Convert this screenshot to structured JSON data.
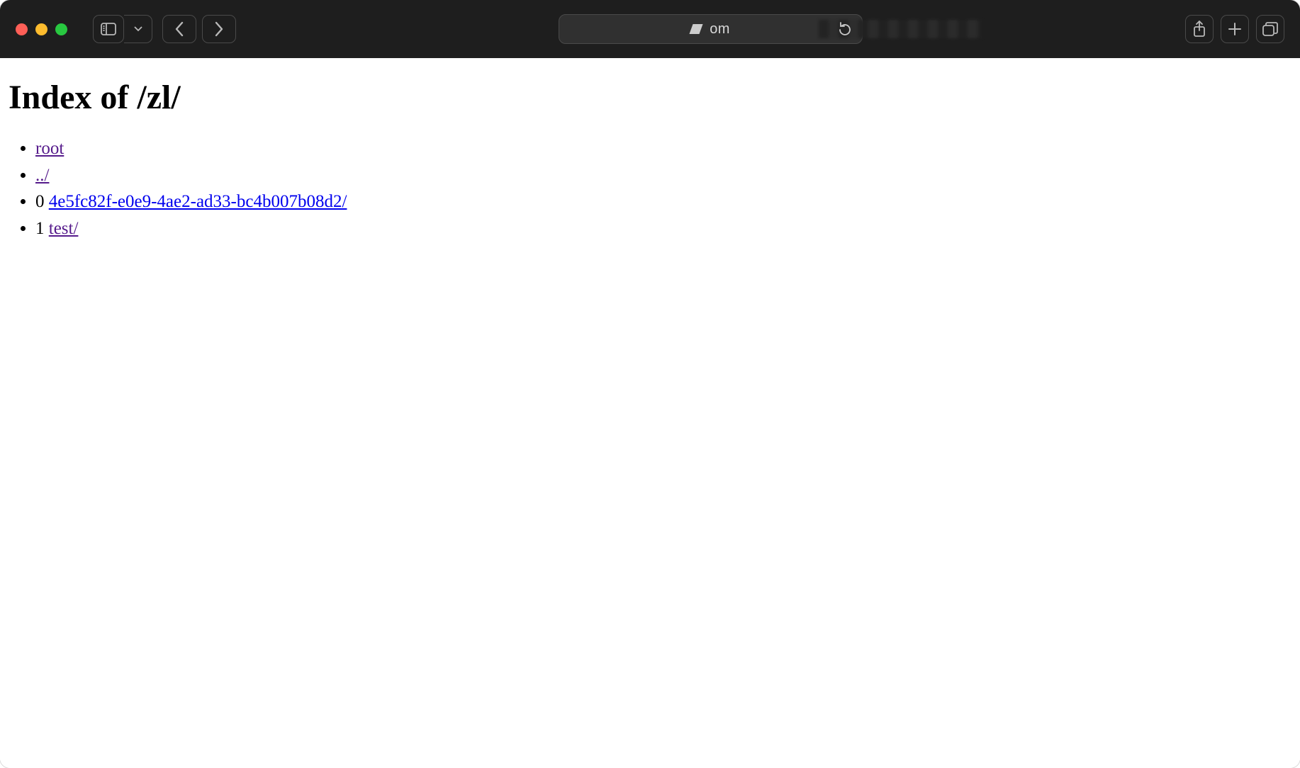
{
  "toolbar": {
    "address_fragment": "om"
  },
  "page": {
    "title": "Index of /zl/",
    "items": [
      {
        "prefix": "",
        "label": "root",
        "visited": true
      },
      {
        "prefix": "",
        "label": "../",
        "visited": true
      },
      {
        "prefix": "0 ",
        "label": "4e5fc82f-e0e9-4ae2-ad33-bc4b007b08d2/",
        "visited": false
      },
      {
        "prefix": "1 ",
        "label": "test/",
        "visited": true
      }
    ]
  }
}
